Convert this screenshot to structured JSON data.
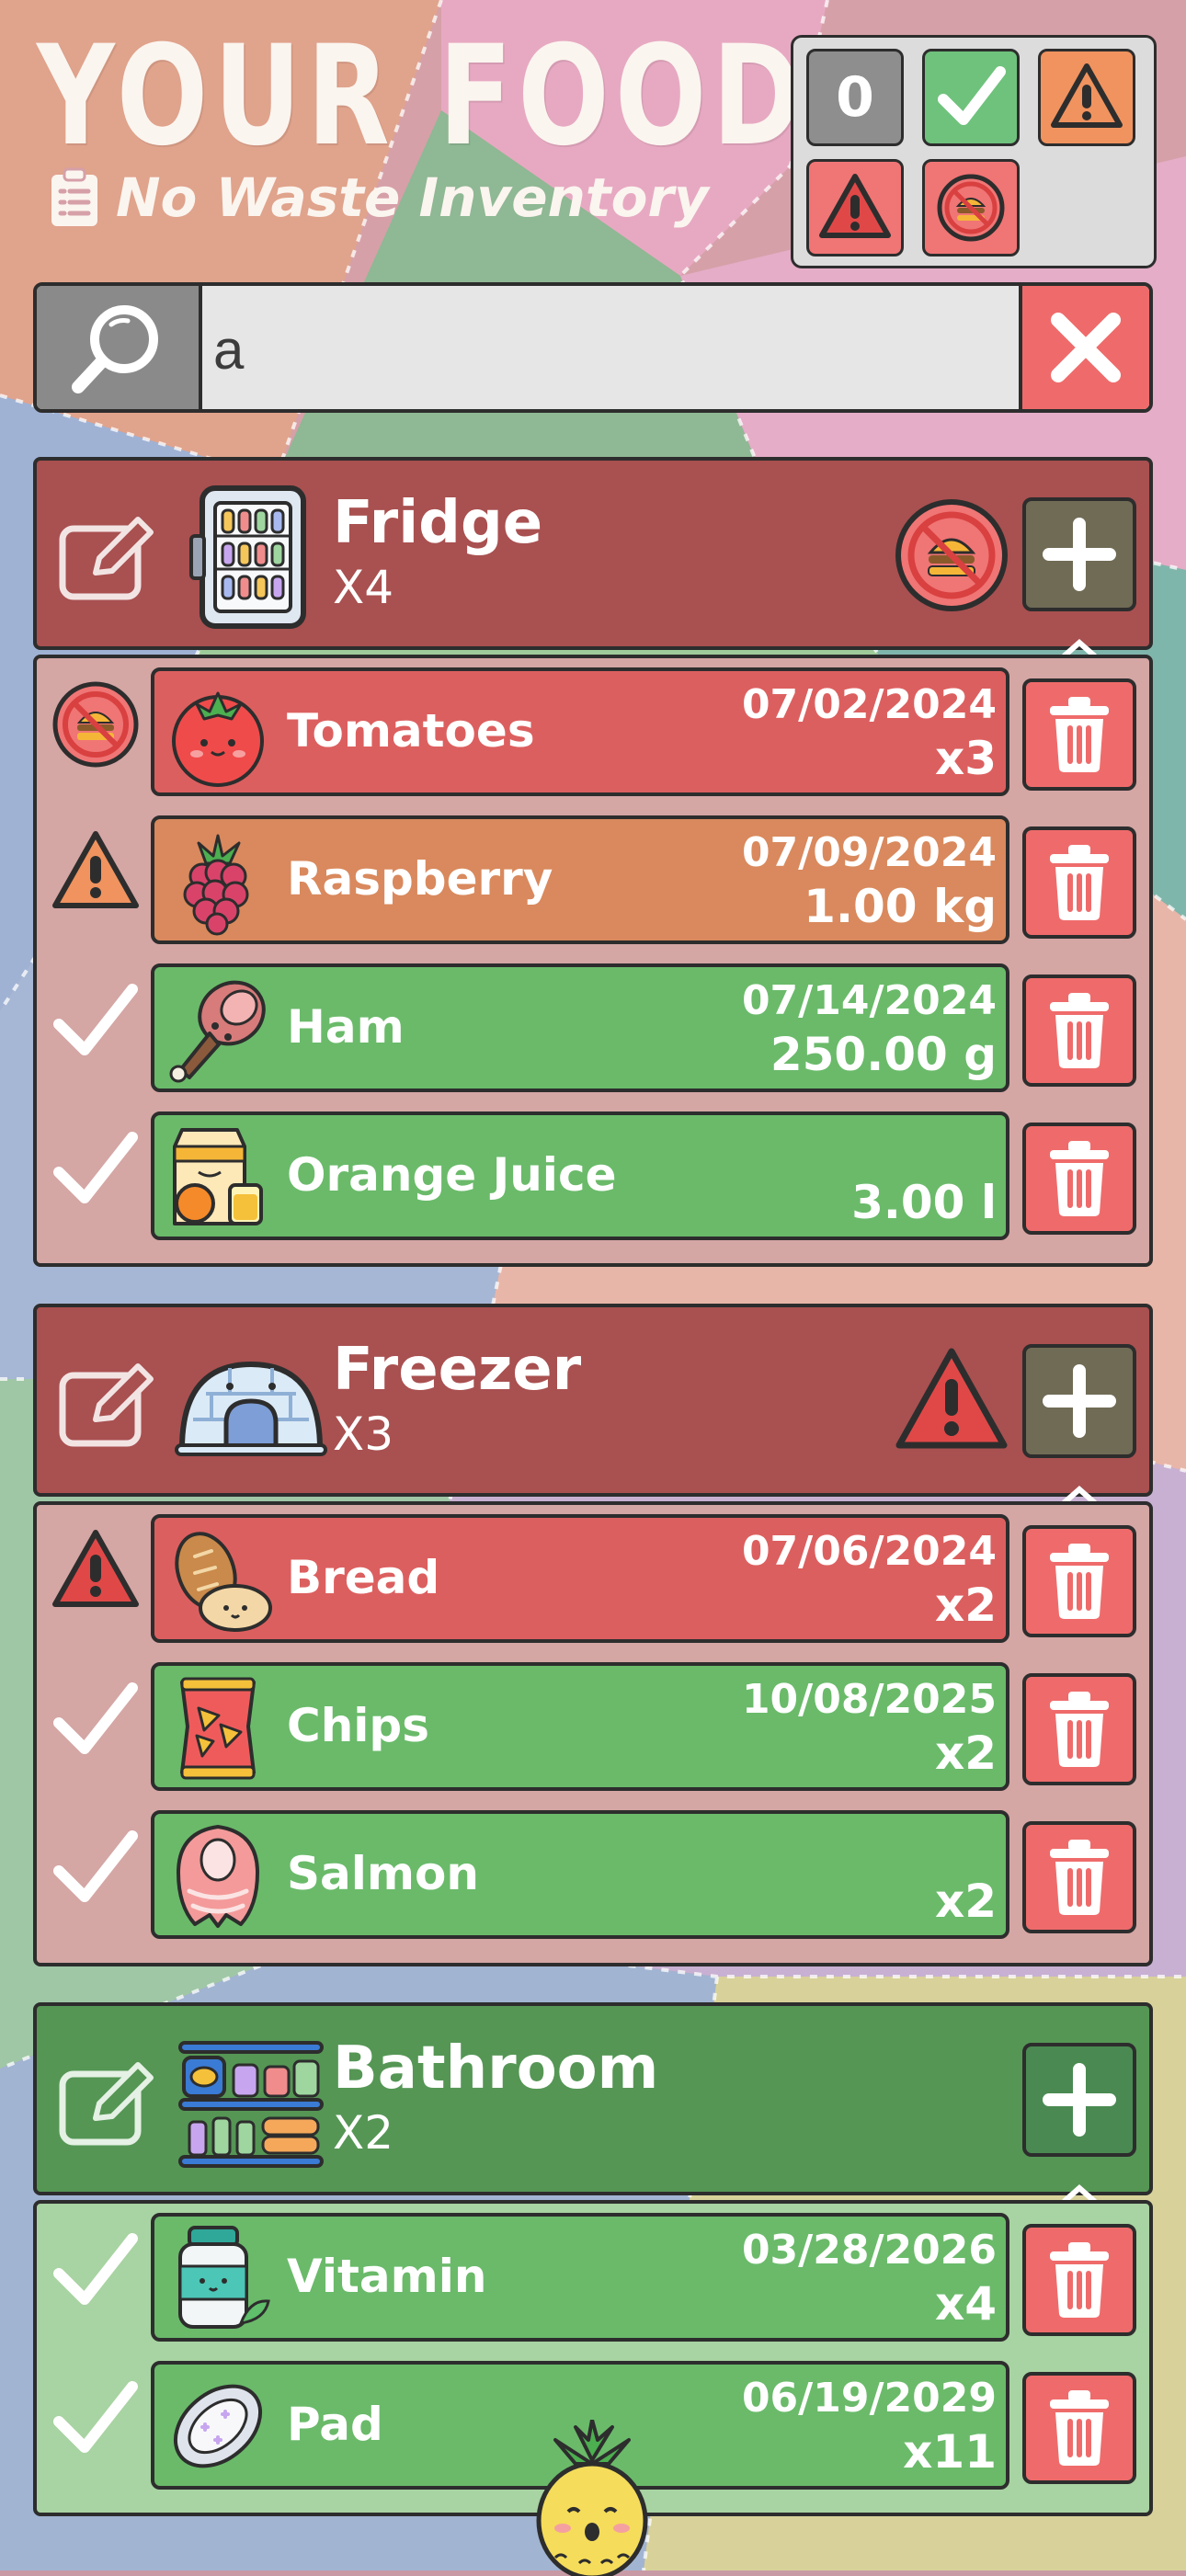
{
  "app": {
    "title": "YOUR FOOD",
    "subtitle": "No Waste Inventory"
  },
  "filters": {
    "count_value": "0",
    "buttons": [
      {
        "icon": "checkmark-icon",
        "color": "#6fc27c"
      },
      {
        "icon": "warning-icon",
        "color": "#f0935f"
      },
      {
        "icon": "danger-icon",
        "color": "#f07575"
      },
      {
        "icon": "no-food-icon",
        "color": "#f07575"
      }
    ]
  },
  "search": {
    "value": "a",
    "search_icon": "magnifier-icon",
    "clear_icon": "close-icon"
  },
  "locations": [
    {
      "name": "Fridge",
      "count": "X4",
      "status_icon": "no-food-icon",
      "color": "#a95050",
      "items": [
        {
          "name": "Tomatoes",
          "date": "07/02/2024",
          "qty": "x3",
          "status": "no-food-icon",
          "bar_color": "#dc5f5f",
          "picture": "tomato-icon"
        },
        {
          "name": "Raspberry",
          "date": "07/09/2024",
          "qty": "1.00 kg",
          "status": "warning-icon",
          "bar_color": "#d9895d",
          "picture": "raspberry-icon"
        },
        {
          "name": "Ham",
          "date": "07/14/2024",
          "qty": "250.00 g",
          "status": "checkmark-icon",
          "bar_color": "#6aba6a",
          "picture": "ham-icon"
        },
        {
          "name": "Orange Juice",
          "date": "",
          "qty": "3.00 l",
          "status": "checkmark-icon",
          "bar_color": "#6aba6a",
          "picture": "orange-juice-icon"
        }
      ]
    },
    {
      "name": "Freezer",
      "count": "X3",
      "status_icon": "danger-icon",
      "color": "#a95050",
      "items": [
        {
          "name": "Bread",
          "date": "07/06/2024",
          "qty": "x2",
          "status": "danger-icon",
          "bar_color": "#dc5f5f",
          "picture": "bread-icon"
        },
        {
          "name": "Chips",
          "date": "10/08/2025",
          "qty": "x2",
          "status": "checkmark-icon",
          "bar_color": "#6aba6a",
          "picture": "chips-icon"
        },
        {
          "name": "Salmon",
          "date": "",
          "qty": "x2",
          "status": "checkmark-icon",
          "bar_color": "#6aba6a",
          "picture": "salmon-icon"
        }
      ]
    },
    {
      "name": "Bathroom",
      "count": "X2",
      "status_icon": "",
      "color": "#559655",
      "items": [
        {
          "name": "Vitamin",
          "date": "03/28/2026",
          "qty": "x4",
          "status": "checkmark-icon",
          "bar_color": "#6aba6a",
          "picture": "vitamin-icon"
        },
        {
          "name": "Pad",
          "date": "06/19/2029",
          "qty": "x11",
          "status": "checkmark-icon",
          "bar_color": "#6aba6a",
          "picture": "pad-icon"
        }
      ]
    }
  ]
}
